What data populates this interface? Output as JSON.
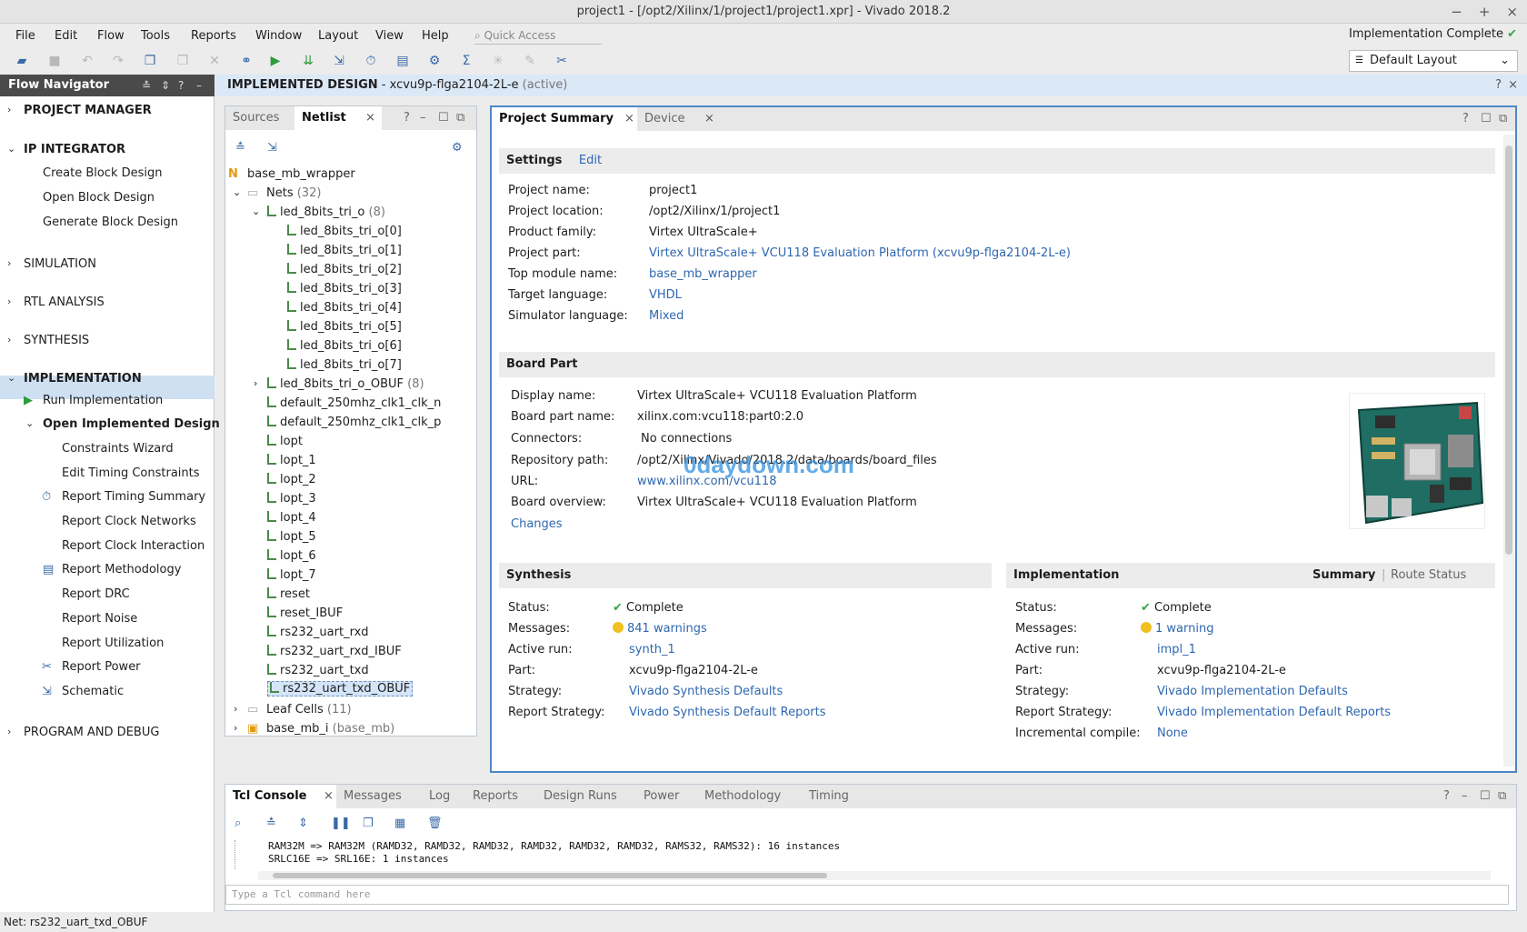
{
  "window": {
    "title": "project1 - [/opt2/Xilinx/1/project1/project1.xpr] - Vivado 2018.2"
  },
  "menu": [
    "File",
    "Edit",
    "Flow",
    "Tools",
    "Reports",
    "Window",
    "Layout",
    "View",
    "Help"
  ],
  "quick_access": {
    "placeholder": "Quick Access"
  },
  "impl_status": "Implementation Complete",
  "layout_select": "Default Layout",
  "flow_navigator": {
    "title": "Flow Navigator",
    "project_manager": "PROJECT MANAGER",
    "ip_integrator": "IP INTEGRATOR",
    "ip_items": [
      "Create Block Design",
      "Open Block Design",
      "Generate Block Design"
    ],
    "simulation": "SIMULATION",
    "rtl": "RTL ANALYSIS",
    "synthesis": "SYNTHESIS",
    "implementation": "IMPLEMENTATION",
    "run_impl": "Run Implementation",
    "open_impl": "Open Implemented Design",
    "impl_items": [
      "Constraints Wizard",
      "Edit Timing Constraints",
      "Report Timing Summary",
      "Report Clock Networks",
      "Report Clock Interaction",
      "Report Methodology",
      "Report DRC",
      "Report Noise",
      "Report Utilization",
      "Report Power",
      "Schematic"
    ],
    "program": "PROGRAM AND DEBUG"
  },
  "design_header": {
    "title": "IMPLEMENTED DESIGN",
    "part": " - xcvu9p-flga2104-2L-e",
    "state": "(active)"
  },
  "netlist": {
    "tabs": [
      "Sources",
      "Netlist"
    ],
    "root": "base_mb_wrapper",
    "nets_label": "Nets",
    "nets_count": "(32)",
    "bus_name": "led_8bits_tri_o",
    "bus_count": "(8)",
    "bus_bits": [
      "led_8bits_tri_o[0]",
      "led_8bits_tri_o[1]",
      "led_8bits_tri_o[2]",
      "led_8bits_tri_o[3]",
      "led_8bits_tri_o[4]",
      "led_8bits_tri_o[5]",
      "led_8bits_tri_o[6]",
      "led_8bits_tri_o[7]"
    ],
    "obuf_name": "led_8bits_tri_o_OBUF",
    "obuf_count": "(8)",
    "nets": [
      "default_250mhz_clk1_clk_n",
      "default_250mhz_clk1_clk_p",
      "lopt",
      "lopt_1",
      "lopt_2",
      "lopt_3",
      "lopt_4",
      "lopt_5",
      "lopt_6",
      "lopt_7",
      "reset",
      "reset_IBUF",
      "rs232_uart_rxd",
      "rs232_uart_rxd_IBUF",
      "rs232_uart_txd",
      "rs232_uart_txd_OBUF"
    ],
    "leaf_label": "Leaf Cells",
    "leaf_count": "(11)",
    "inst_label": "base_mb_i",
    "inst_type": "(base_mb)"
  },
  "summary": {
    "tabs": [
      "Project Summary",
      "Device"
    ],
    "settings": {
      "title": "Settings",
      "edit": "Edit",
      "rows": [
        {
          "k": "Project name:",
          "v": "project1",
          "link": false
        },
        {
          "k": "Project location:",
          "v": "/opt2/Xilinx/1/project1",
          "link": false
        },
        {
          "k": "Product family:",
          "v": "Virtex UltraScale+",
          "link": false
        },
        {
          "k": "Project part:",
          "v": "Virtex UltraScale+ VCU118 Evaluation Platform (xcvu9p-flga2104-2L-e)",
          "link": true
        },
        {
          "k": "Top module name:",
          "v": "base_mb_wrapper",
          "link": true
        },
        {
          "k": "Target language:",
          "v": "VHDL",
          "link": true
        },
        {
          "k": "Simulator language:",
          "v": "Mixed",
          "link": true
        }
      ]
    },
    "board": {
      "title": "Board Part",
      "rows": [
        {
          "k": "Display name:",
          "v": "Virtex UltraScale+ VCU118 Evaluation Platform",
          "link": false
        },
        {
          "k": "Board part name:",
          "v": "xilinx.com:vcu118:part0:2.0",
          "link": false
        },
        {
          "k": "Connectors:",
          "v": "No connections",
          "link": false
        },
        {
          "k": "Repository path:",
          "v": "/opt2/Xilinx/Vivado/2018.2/data/boards/board_files",
          "link": false
        },
        {
          "k": "URL:",
          "v": "www.xilinx.com/vcu118",
          "link": true
        },
        {
          "k": "Board overview:",
          "v": "Virtex UltraScale+ VCU118 Evaluation Platform",
          "link": false
        }
      ],
      "changes": "Changes",
      "watermark": "0daydown.com"
    },
    "synthesis": {
      "title": "Synthesis",
      "rows": [
        {
          "k": "Status:",
          "v": "Complete"
        },
        {
          "k": "Messages:",
          "v": "841 warnings"
        },
        {
          "k": "Active run:",
          "v": "synth_1"
        },
        {
          "k": "Part:",
          "v": "xcvu9p-flga2104-2L-e"
        },
        {
          "k": "Strategy:",
          "v": "Vivado Synthesis Defaults"
        },
        {
          "k": "Report Strategy:",
          "v": "Vivado Synthesis Default Reports"
        }
      ]
    },
    "implementation": {
      "title": "Implementation",
      "summary_tab": "Summary",
      "route_tab": "Route Status",
      "rows": [
        {
          "k": "Status:",
          "v": "Complete"
        },
        {
          "k": "Messages:",
          "v": "1 warning"
        },
        {
          "k": "Active run:",
          "v": "impl_1"
        },
        {
          "k": "Part:",
          "v": "xcvu9p-flga2104-2L-e"
        },
        {
          "k": "Strategy:",
          "v": "Vivado Implementation Defaults"
        },
        {
          "k": "Report Strategy:",
          "v": "Vivado Implementation Default Reports"
        },
        {
          "k": "Incremental compile:",
          "v": "None"
        }
      ]
    }
  },
  "console": {
    "tabs": [
      "Tcl Console",
      "Messages",
      "Log",
      "Reports",
      "Design Runs",
      "Power",
      "Methodology",
      "Timing"
    ],
    "lines": [
      "RAM32M => RAM32M (RAMD32, RAMD32, RAMD32, RAMD32, RAMD32, RAMD32, RAMS32, RAMS32): 16 instances",
      "SRLC16E => SRL16E: 1 instances"
    ],
    "input_placeholder": "Type a Tcl command here"
  },
  "status_bar": "Net: rs232_uart_txd_OBUF"
}
